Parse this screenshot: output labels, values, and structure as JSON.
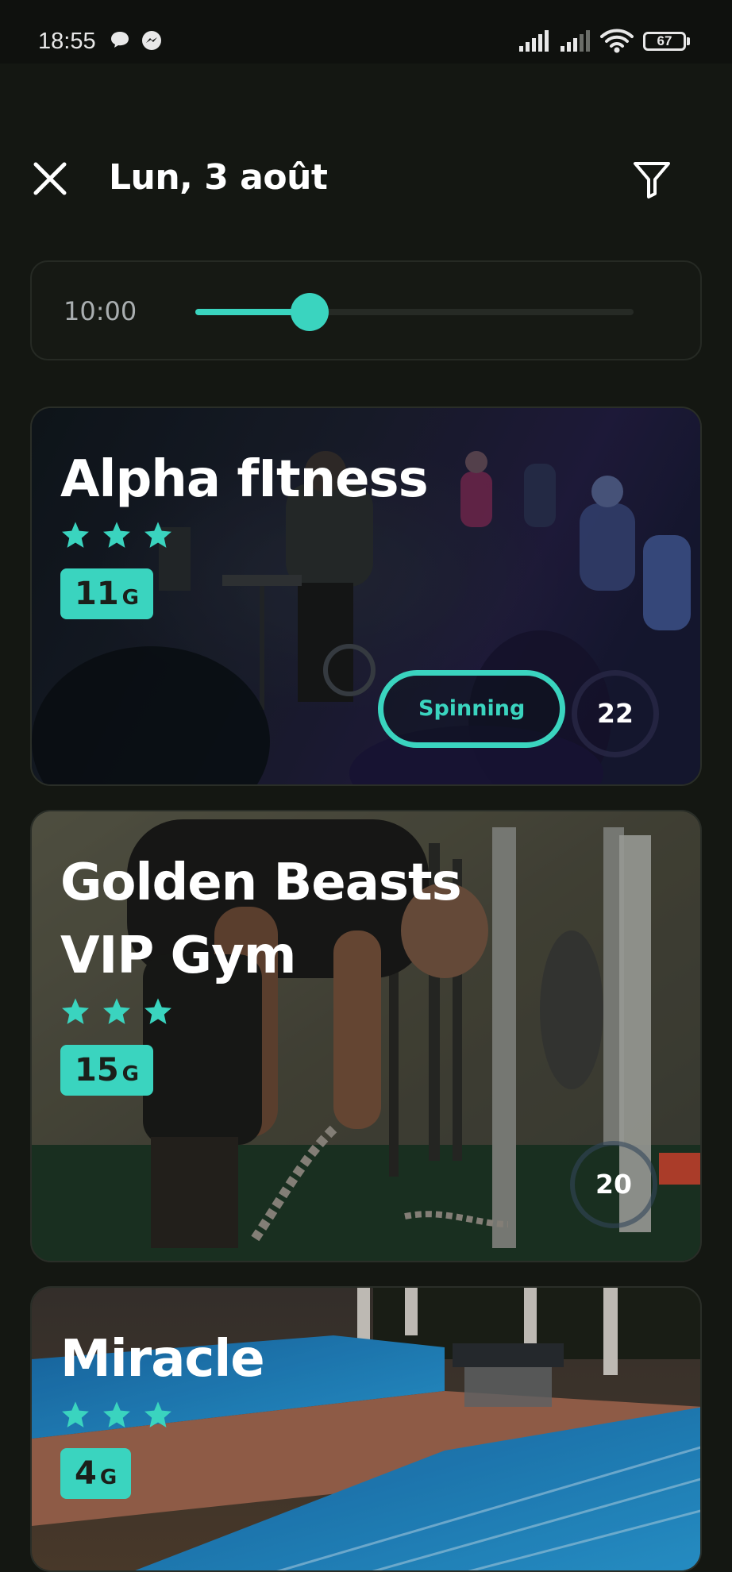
{
  "status_bar": {
    "time": "18:55",
    "battery": "67",
    "icons": [
      "chat-bubble-icon",
      "messenger-icon",
      "signal-icon",
      "signal-icon",
      "wifi-icon",
      "battery-icon"
    ]
  },
  "header": {
    "title": "Lun, 3 août",
    "close_icon": "close-icon",
    "filter_icon": "filter-icon"
  },
  "time_filter": {
    "label": "10:00",
    "level_fraction": 0.26,
    "accent": "#3ad4bf"
  },
  "gyms": [
    {
      "name": "Alpha fItness",
      "rating": 3,
      "price": "11",
      "price_unit": "G",
      "tag": "Spinning",
      "count": "22",
      "photo": "indoor spinning class, dark blue tones"
    },
    {
      "name": "Golden Beasts VIP Gym",
      "rating": 3,
      "price": "15",
      "price_unit": "G",
      "tag": "",
      "count": "20",
      "photo": "weight room with man lifting chains"
    },
    {
      "name": "Miracle",
      "rating": 3,
      "price": "4",
      "price_unit": "G",
      "tag": "",
      "count": "",
      "photo": "outdoor swimming pool"
    }
  ],
  "colors": {
    "background": "#141712",
    "accent": "#3ad4bf",
    "card_border": "#2a2e28"
  }
}
